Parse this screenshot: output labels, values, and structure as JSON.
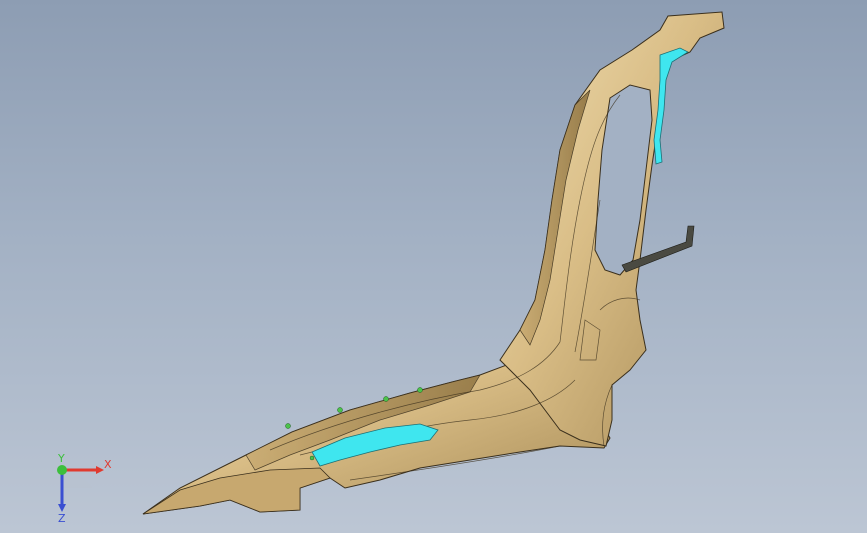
{
  "viewport": {
    "background_top": "#8d9db3",
    "background_bottom": "#bcc6d4"
  },
  "model": {
    "part_color": "#d9bd86",
    "part_highlight": "#f1dfb2",
    "part_shadow": "#a68a55",
    "edge_color": "#3a2f1c",
    "selection_color": "#3fe6ef",
    "feature_point_color": "#4bc24b"
  },
  "triad": {
    "x_label": "X",
    "y_label": "Y",
    "z_label": "Z",
    "x_color": "#e03a2f",
    "y_color": "#3cbf3c",
    "z_color": "#3a4fd1"
  }
}
